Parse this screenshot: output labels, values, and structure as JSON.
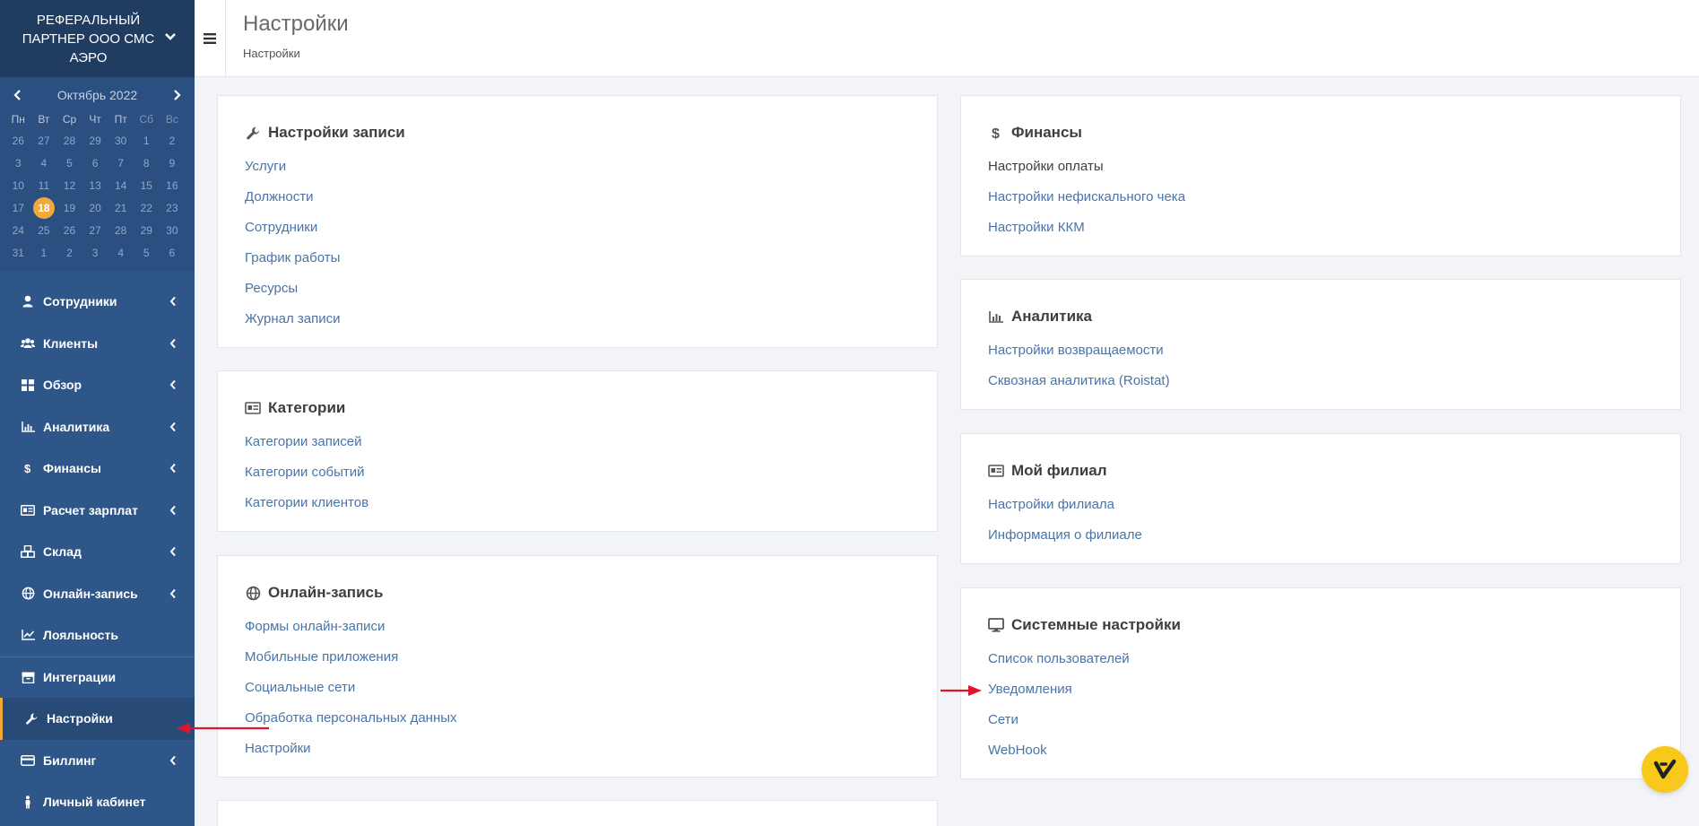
{
  "company": {
    "name": "РЕФЕРАЛЬНЫЙ ПАРТНЕР ООО СМС АЭРО"
  },
  "calendar": {
    "title": "Октябрь 2022",
    "weekdays": [
      "Пн",
      "Вт",
      "Ср",
      "Чт",
      "Пт",
      "Сб",
      "Вс"
    ],
    "weeks": [
      [
        "26",
        "27",
        "28",
        "29",
        "30",
        "1",
        "2"
      ],
      [
        "3",
        "4",
        "5",
        "6",
        "7",
        "8",
        "9"
      ],
      [
        "10",
        "11",
        "12",
        "13",
        "14",
        "15",
        "16"
      ],
      [
        "17",
        "18",
        "19",
        "20",
        "21",
        "22",
        "23"
      ],
      [
        "24",
        "25",
        "26",
        "27",
        "28",
        "29",
        "30"
      ],
      [
        "31",
        "1",
        "2",
        "3",
        "4",
        "5",
        "6"
      ]
    ],
    "today": "18"
  },
  "sidebar": {
    "items": [
      {
        "label": "Сотрудники",
        "icon": "user-icon",
        "arrow": true
      },
      {
        "label": "Клиенты",
        "icon": "users-icon",
        "arrow": true
      },
      {
        "label": "Обзор",
        "icon": "grid-icon",
        "arrow": true
      },
      {
        "label": "Аналитика",
        "icon": "chart-icon",
        "arrow": true
      },
      {
        "label": "Финансы",
        "icon": "dollar-icon",
        "arrow": true
      },
      {
        "label": "Расчет зарплат",
        "icon": "id-card-icon",
        "arrow": true
      },
      {
        "label": "Склад",
        "icon": "cubes-icon",
        "arrow": true
      },
      {
        "label": "Онлайн-запись",
        "icon": "globe-icon",
        "arrow": true
      },
      {
        "label": "Лояльность",
        "icon": "trend-icon",
        "arrow": false
      },
      {
        "label": "Интеграции",
        "icon": "archive-icon",
        "arrow": false
      },
      {
        "label": "Настройки",
        "icon": "wrench-icon",
        "arrow": false
      },
      {
        "label": "Биллинг",
        "icon": "credit-card-icon",
        "arrow": true
      },
      {
        "label": "Личный кабинет",
        "icon": "person-icon",
        "arrow": false
      }
    ]
  },
  "header": {
    "title": "Настройки",
    "breadcrumb": "Настройки"
  },
  "cards": {
    "records": {
      "title": "Настройки записи",
      "links": [
        "Услуги",
        "Должности",
        "Сотрудники",
        "График работы",
        "Ресурсы",
        "Журнал записи"
      ]
    },
    "categories": {
      "title": "Категории",
      "links": [
        "Категории записей",
        "Категории событий",
        "Категории клиентов"
      ]
    },
    "online": {
      "title": "Онлайн-запись",
      "links": [
        "Формы онлайн-записи",
        "Мобильные приложения",
        "Социальные сети",
        "Обработка персональных данных",
        "Настройки"
      ]
    },
    "finance": {
      "title": "Финансы",
      "links": [
        "Настройки оплаты",
        "Настройки нефискального чека",
        "Настройки ККМ"
      ]
    },
    "analytics": {
      "title": "Аналитика",
      "links": [
        "Настройки возвращаемости",
        "Сквозная аналитика (Roistat)"
      ]
    },
    "branch": {
      "title": "Мой филиал",
      "links": [
        "Настройки филиала",
        "Информация о филиале"
      ]
    },
    "system": {
      "title": "Системные настройки",
      "links": [
        "Список пользователей",
        "Уведомления",
        "Сети",
        "WebHook"
      ]
    }
  },
  "colors": {
    "sidebar": "#2f5688",
    "accent": "#f2a93b",
    "link": "#4a74a8",
    "annotation": "#e3122f",
    "help": "#f8c81a"
  }
}
